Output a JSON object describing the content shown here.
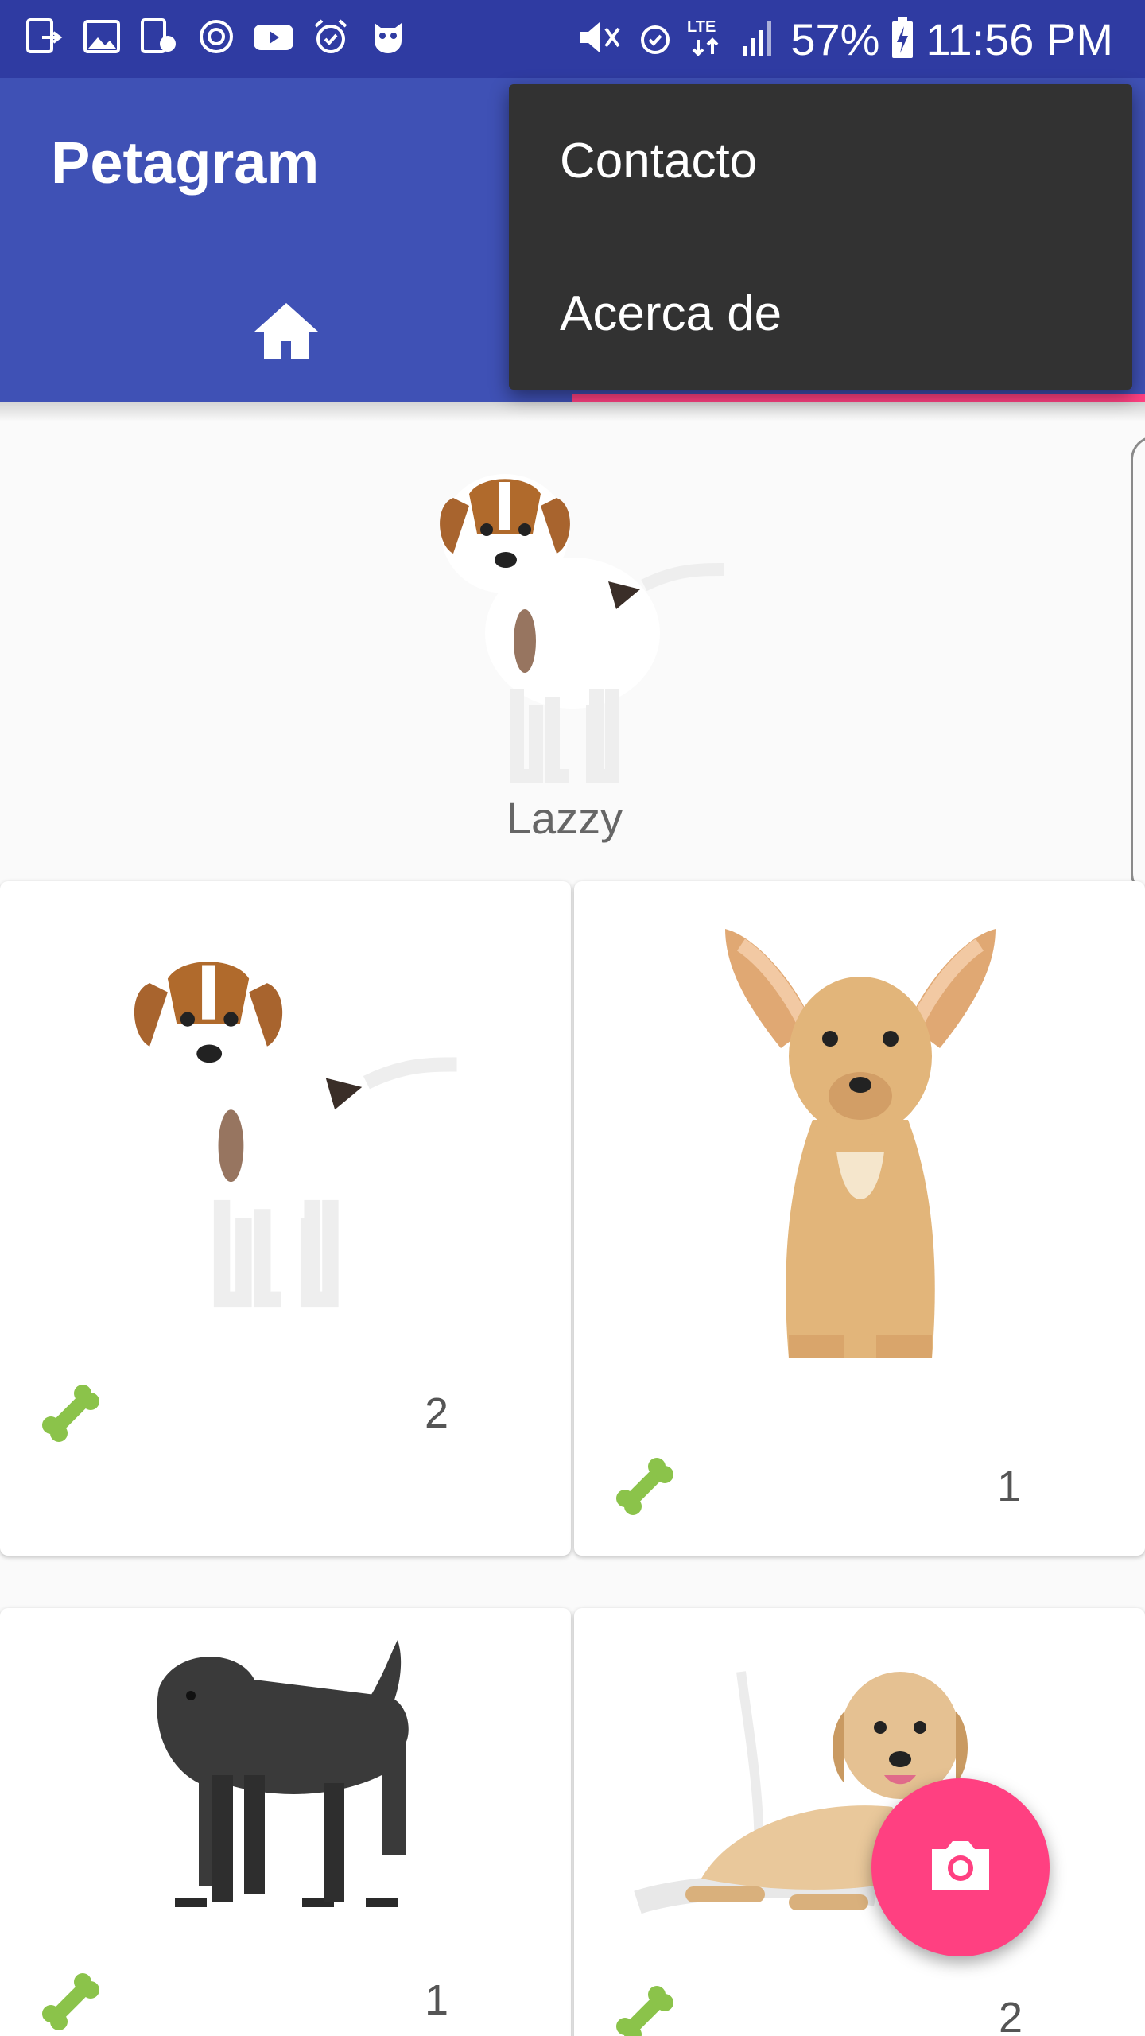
{
  "status_bar": {
    "battery": "57%",
    "time": "11:56 PM",
    "network": "LTE",
    "left_icons": [
      "screen-cast-icon",
      "image-icon",
      "device-timer-icon",
      "sync-icon",
      "youtube-icon",
      "alarm-icon",
      "owl-icon"
    ],
    "right_icons": [
      "mute-icon",
      "alarm-icon",
      "lte-icon",
      "signal-icon",
      "battery-charging-icon"
    ]
  },
  "app_bar": {
    "title": "Petagram",
    "tabs": [
      {
        "icon": "home-icon",
        "selected": false
      },
      {
        "icon": "",
        "selected": true
      }
    ],
    "colors": {
      "primary": "#3f51b5",
      "status": "#2f3ba2",
      "accent": "#ff4081"
    }
  },
  "overflow_menu": {
    "items": [
      "Contacto",
      "Acerca de"
    ]
  },
  "featured_pet": {
    "name": "Lazzy",
    "image": "puppy-jack-russell"
  },
  "pets": [
    {
      "image": "puppy-jack-russell",
      "likes": "2",
      "like_icon": "bone-icon"
    },
    {
      "image": "chihuahua",
      "likes": "1",
      "like_icon": "bone-icon"
    },
    {
      "image": "affenpinscher-black",
      "likes": "1",
      "like_icon": "bone-icon"
    },
    {
      "image": "labrador-puppy",
      "likes": "2",
      "like_icon": "bone-icon"
    }
  ],
  "fab": {
    "icon": "camera-icon"
  }
}
